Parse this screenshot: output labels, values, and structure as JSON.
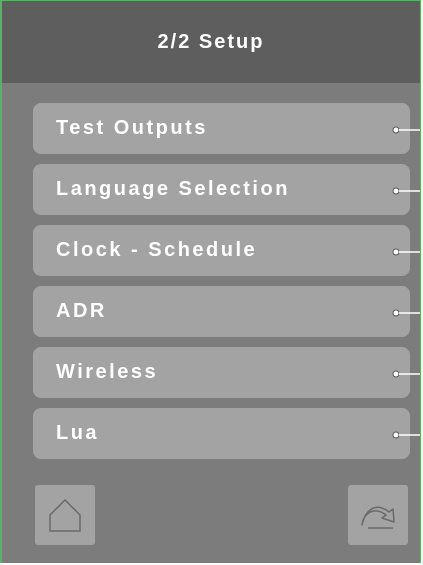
{
  "header": {
    "title": "2/2 Setup"
  },
  "menu": {
    "items": [
      {
        "label": "Test Outputs"
      },
      {
        "label": "Language Selection"
      },
      {
        "label": "Clock - Schedule"
      },
      {
        "label": "ADR"
      },
      {
        "label": "Wireless"
      },
      {
        "label": "Lua"
      }
    ]
  },
  "footer": {
    "home_icon": "home-icon",
    "back_icon": "return-arrow-icon"
  },
  "colors": {
    "header_bg": "#5e5e5e",
    "panel_bg": "#7c7c7c",
    "button_bg": "#a3a3a3",
    "text": "#ffffff",
    "border_accent": "#5fae6a"
  }
}
